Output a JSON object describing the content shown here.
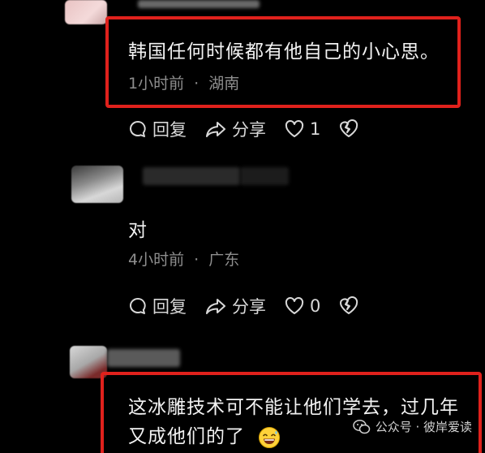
{
  "comments": [
    {
      "text": "韩国任何时候都有他自己的小心思。",
      "time": "1小时前",
      "separator": "·",
      "location": "湖南",
      "reply_label": "回复",
      "share_label": "分享",
      "likes": "1"
    },
    {
      "text": "对",
      "time": "4小时前",
      "separator": "·",
      "location": "广东",
      "reply_label": "回复",
      "share_label": "分享",
      "likes": "0"
    },
    {
      "text_line1": "这冰雕技术可不能让他们学去，过几年",
      "text_line2": "又成他们的了"
    }
  ],
  "watermark": {
    "text": "公众号 · 彼岸爱读"
  },
  "colors": {
    "background": "#000000",
    "highlight": "#e0211c",
    "meta": "#8e8e8e"
  },
  "icons": [
    "reply-icon",
    "share-icon",
    "heart-icon",
    "dislike-icon",
    "laughing-sweat-emoji",
    "wechat-icon"
  ]
}
